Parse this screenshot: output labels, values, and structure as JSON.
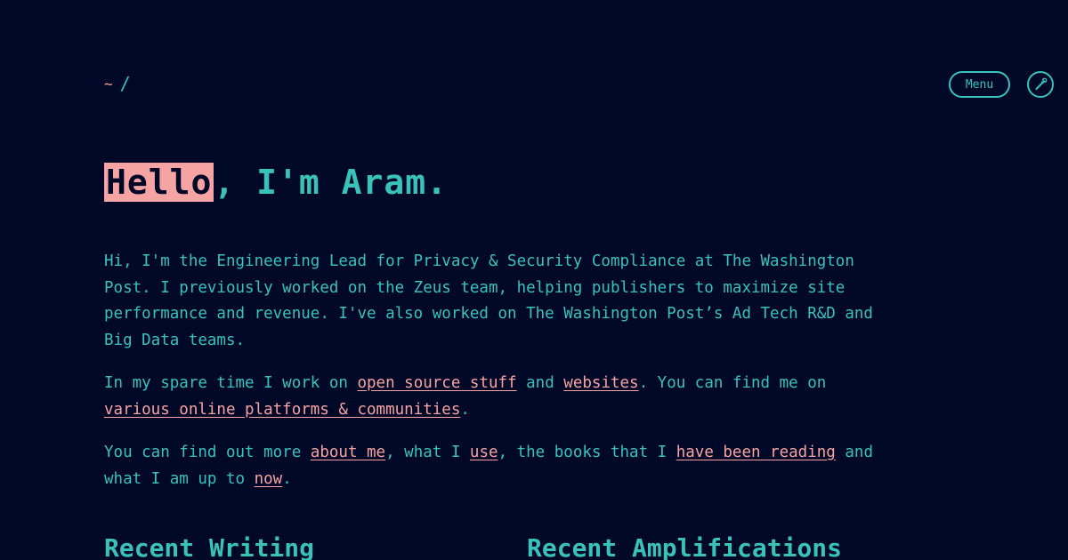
{
  "header": {
    "logo_tilde": "~",
    "logo_slash": "/",
    "menu_label": "Menu",
    "theme_icon": "eyedropper-icon"
  },
  "hero": {
    "greeting_highlight": "Hello",
    "greeting_rest": ", I'm Aram."
  },
  "intro": {
    "p1": "Hi, I'm the Engineering Lead for Privacy & Security Compliance at The Washington Post. I previously worked on the Zeus team, helping publishers to maximize site performance and revenue. I've also worked on The Washington Post’s Ad Tech R&D and Big Data teams.",
    "p2": {
      "t1": "In my spare time I work on ",
      "link_open_source": "open source stuff",
      "t2": " and ",
      "link_websites": "websites",
      "t3": ". You can find me on ",
      "link_platforms": "various online platforms & communities",
      "t4": "."
    },
    "p3": {
      "t1": "You can find out more ",
      "link_about": "about me",
      "t2": ", what I ",
      "link_use": "use",
      "t3": ", the books that I ",
      "link_reading": "have been reading",
      "t4": " and what I am up to ",
      "link_now": "now",
      "t5": "."
    }
  },
  "sections": {
    "recent_writing": "Recent Writing",
    "recent_amplifications": "Recent Amplifications"
  },
  "colors": {
    "background": "#000827",
    "text": "#38c2b8",
    "accent": "#f6a3a3"
  }
}
